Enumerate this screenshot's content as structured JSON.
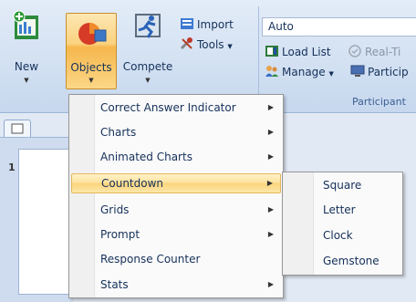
{
  "ribbon": {
    "new_label": "New",
    "objects_label": "Objects",
    "compete_label": "Compete",
    "import_label": "Import",
    "tools_label": "Tools",
    "auto_value": "Auto",
    "load_list_label": "Load List",
    "realtime_label": "Real-Ti",
    "manage_label": "Manage",
    "particip_label": "Particip",
    "group_label": "Participant"
  },
  "slides": {
    "thumb_number": "1"
  },
  "objects_menu": {
    "items": [
      {
        "label": "Correct Answer Indicator",
        "has_submenu": true
      },
      {
        "label": "Charts",
        "has_submenu": true
      },
      {
        "label": "Animated Charts",
        "has_submenu": true
      },
      {
        "label": "Countdown",
        "has_submenu": true
      },
      {
        "label": "Grids",
        "has_submenu": true
      },
      {
        "label": "Prompt",
        "has_submenu": true
      },
      {
        "label": "Response Counter",
        "has_submenu": false
      },
      {
        "label": "Stats",
        "has_submenu": true
      }
    ]
  },
  "countdown_submenu": {
    "items": [
      {
        "label": "Square"
      },
      {
        "label": "Letter"
      },
      {
        "label": "Clock"
      },
      {
        "label": "Gemstone"
      }
    ]
  },
  "colors": {
    "highlight": "#fbd47b",
    "ribbon": "#d3e1f2",
    "menu_bg": "#fafafa"
  }
}
